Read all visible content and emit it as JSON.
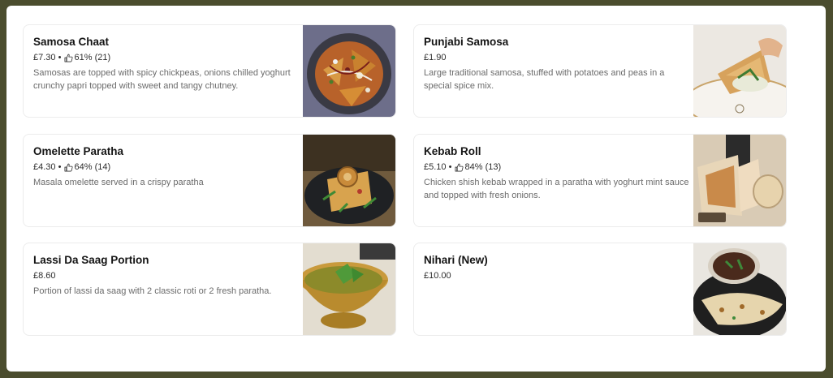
{
  "menu": {
    "items": [
      {
        "name": "Samosa Chaat",
        "price": "£7.30",
        "has_rating": true,
        "rating": "61%",
        "reviews": "(21)",
        "description": "Samosas are topped with spicy chickpeas, onions chilled yoghurt crunchy papri topped with sweet and tangy chutney."
      },
      {
        "name": "Punjabi Samosa",
        "price": "£1.90",
        "has_rating": false,
        "description": "Large traditional samosa, stuffed with potatoes and peas in a special spice mix."
      },
      {
        "name": "Omelette Paratha",
        "price": "£4.30",
        "has_rating": true,
        "rating": "64%",
        "reviews": "(14)",
        "description": "Masala omelette served in a crispy paratha"
      },
      {
        "name": "Kebab Roll",
        "price": "£5.10",
        "has_rating": true,
        "rating": "84%",
        "reviews": "(13)",
        "description": "Chicken shish kebab wrapped in a paratha with yoghurt mint sauce and topped with fresh onions."
      },
      {
        "name": "Lassi Da Saag Portion",
        "price": "£8.60",
        "has_rating": false,
        "description": "Portion of lassi da saag with 2 classic roti or 2 fresh paratha."
      },
      {
        "name": "Nihari (New)",
        "price": "£10.00",
        "has_rating": false,
        "description": ""
      }
    ],
    "meta_separator": " • ",
    "rating_icon": "thumbs-up-icon"
  }
}
